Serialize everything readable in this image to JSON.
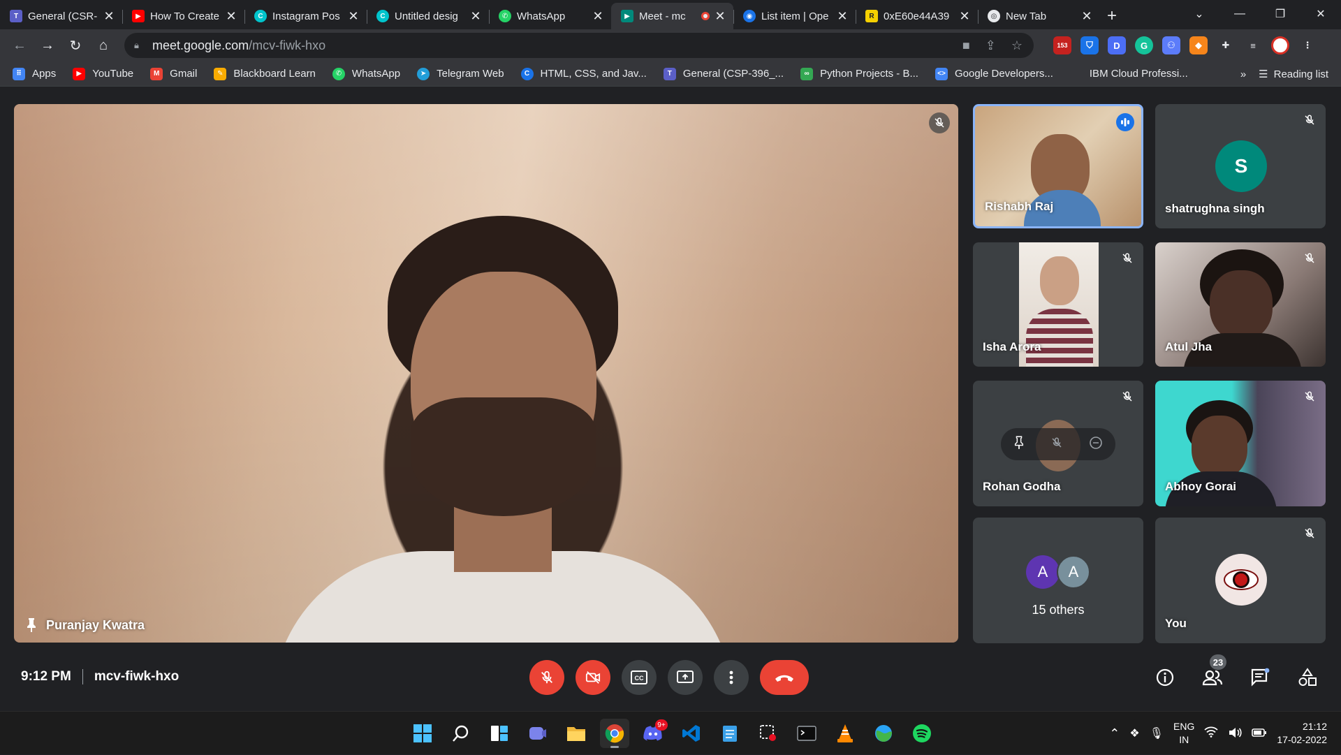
{
  "browser": {
    "tabs": [
      {
        "title": "General (CSR-",
        "icon": "teams-icon",
        "color": "#5b5fc7"
      },
      {
        "title": "How To Create",
        "icon": "youtube-icon",
        "color": "#ff0000"
      },
      {
        "title": "Instagram Pos",
        "icon": "canva-icon",
        "color": "#00c4cc"
      },
      {
        "title": "Untitled desig",
        "icon": "canva-icon",
        "color": "#00c4cc"
      },
      {
        "title": "WhatsApp",
        "icon": "whatsapp-icon",
        "color": "#25d366"
      },
      {
        "title": "Meet - mc",
        "icon": "meet-icon",
        "color": "#00897b",
        "active": true
      },
      {
        "title": "List item | Ope",
        "icon": "openlib-icon",
        "color": "#1a73e8"
      },
      {
        "title": "0xE60e44A39",
        "icon": "token-icon",
        "color": "#f5d000"
      },
      {
        "title": "New Tab",
        "icon": "chrome-icon",
        "color": "#9aa0a6"
      }
    ],
    "url_host": "meet.google.com",
    "url_path": "/mcv-fiwk-hxo",
    "ext_badge": "153",
    "bookmarks": [
      {
        "label": "Apps",
        "color": "#4285f4"
      },
      {
        "label": "YouTube",
        "color": "#ff0000"
      },
      {
        "label": "Gmail",
        "color": "#ea4335"
      },
      {
        "label": "Blackboard Learn",
        "color": "#f9ab00"
      },
      {
        "label": "WhatsApp",
        "color": "#25d366"
      },
      {
        "label": "Telegram Web",
        "color": "#229ed9"
      },
      {
        "label": "HTML, CSS, and Jav...",
        "color": "#1a73e8"
      },
      {
        "label": "General (CSP-396_...",
        "color": "#5b5fc7"
      },
      {
        "label": "Python Projects - B...",
        "color": "#34a853"
      },
      {
        "label": "Google Developers...",
        "color": "#4285f4"
      },
      {
        "label": "IBM Cloud Professi...",
        "color": "#35363a"
      }
    ],
    "reading_list": "Reading list"
  },
  "meet": {
    "main_speaker": "Puranjay Kwatra",
    "participants": [
      {
        "name": "Rishabh Raj",
        "kind": "video",
        "speaking": true
      },
      {
        "name": "shatrughna singh",
        "kind": "avatar",
        "initial": "S",
        "color": "#00897b"
      },
      {
        "name": "Isha Arora",
        "kind": "video"
      },
      {
        "name": "Atul Jha",
        "kind": "video"
      },
      {
        "name": "Rohan Godha",
        "kind": "hover"
      },
      {
        "name": "Abhoy Gorai",
        "kind": "video"
      },
      {
        "name": "15 others",
        "kind": "others",
        "initials": [
          "A",
          "A"
        ]
      },
      {
        "name": "You",
        "kind": "self"
      }
    ],
    "time": "9:12 PM",
    "meeting_code": "mcv-fiwk-hxo",
    "people_count": "23"
  },
  "taskbar": {
    "lang_top": "ENG",
    "lang_bottom": "IN",
    "time": "21:12",
    "date": "17-02-2022",
    "chat_badge": "9+"
  }
}
